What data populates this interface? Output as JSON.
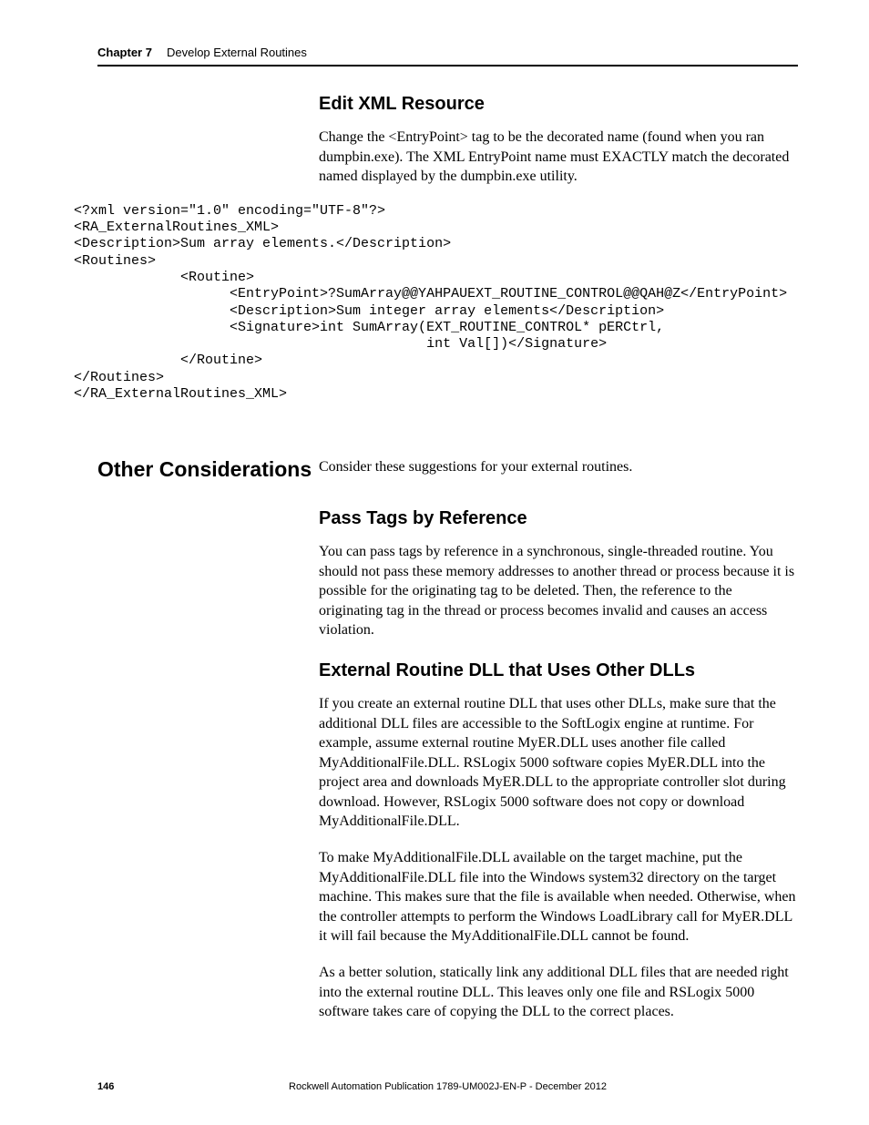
{
  "header": {
    "chapter_label": "Chapter 7",
    "chapter_title": "Develop External Routines"
  },
  "section1": {
    "heading": "Edit XML Resource",
    "para": "Change the <EntryPoint> tag to be the decorated name (found when you ran dumpbin.exe). The XML EntryPoint name must EXACTLY match the decorated named displayed by the dumpbin.exe utility."
  },
  "code_block": "<?xml version=\"1.0\" encoding=\"UTF-8\"?>\n<RA_ExternalRoutines_XML>\n<Description>Sum array elements.</Description>\n<Routines>\n             <Routine>\n                   <EntryPoint>?SumArray@@YAHPAUEXT_ROUTINE_CONTROL@@QAH@Z</EntryPoint>\n                   <Description>Sum integer array elements</Description>\n                   <Signature>int SumArray(EXT_ROUTINE_CONTROL* pERCtrl,\n                                           int Val[])</Signature>\n             </Routine>\n</Routines>\n</RA_ExternalRoutines_XML>",
  "section2": {
    "side_heading": "Other Considerations",
    "intro": "Consider these suggestions for your external routines.",
    "sub1_heading": "Pass Tags by Reference",
    "sub1_para": "You can pass tags by reference in a synchronous, single-threaded routine. You should not pass these memory addresses to another thread or process because it is possible for the originating tag to be deleted. Then, the reference to the originating tag in the thread or process becomes invalid and causes an access violation.",
    "sub2_heading": "External Routine DLL that Uses Other DLLs",
    "sub2_para1": "If you create an external routine DLL that uses other DLLs, make sure that the additional DLL files are accessible to the SoftLogix engine at runtime. For example, assume external routine MyER.DLL uses another file called MyAdditionalFile.DLL. RSLogix 5000 software copies MyER.DLL into the project area and downloads MyER.DLL to the appropriate controller slot during download. However, RSLogix 5000 software does not copy or download MyAdditionalFile.DLL.",
    "sub2_para2": "To make MyAdditionalFile.DLL available on the target machine, put the MyAdditionalFile.DLL file into the Windows system32 directory on the target machine. This makes sure that the file is available when needed. Otherwise, when the controller attempts to perform the Windows LoadLibrary call for MyER.DLL it will fail because the MyAdditionalFile.DLL cannot be found.",
    "sub2_para3": "As a better solution, statically link any additional DLL files that are needed right into the external routine DLL. This leaves only one file and RSLogix 5000 software takes care of copying the DLL to the correct places."
  },
  "footer": {
    "page_number": "146",
    "publication": "Rockwell Automation Publication 1789-UM002J-EN-P - December 2012"
  }
}
